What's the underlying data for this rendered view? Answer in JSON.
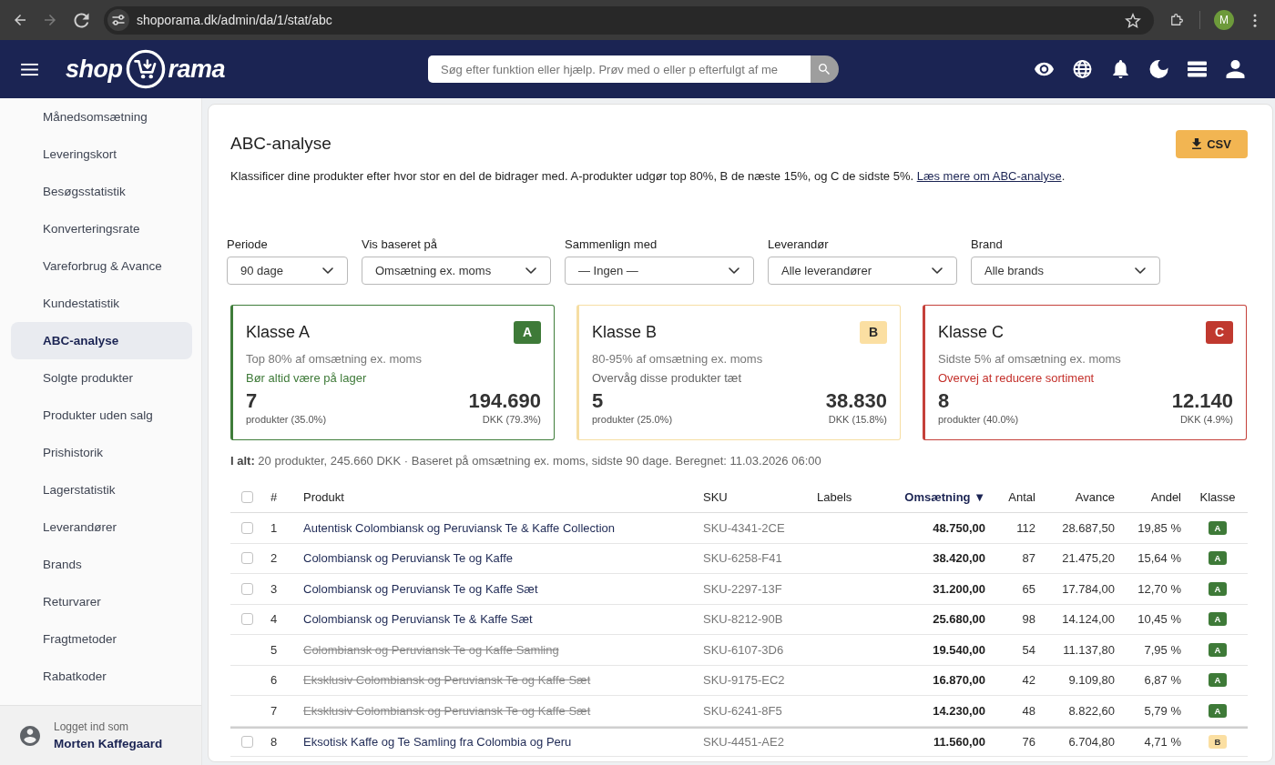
{
  "browser": {
    "url": "shoporama.dk/admin/da/1/stat/abc",
    "avatar": "M"
  },
  "header": {
    "logo": {
      "left": "shop",
      "right": "rama"
    },
    "search": {
      "placeholder": "Søg efter funktion eller hjælp. Prøv med o eller p efterfulgt af me"
    }
  },
  "sidebar": {
    "items": [
      {
        "label": "Månedsomsætning",
        "selected": false
      },
      {
        "label": "Leveringskort",
        "selected": false
      },
      {
        "label": "Besøgsstatistik",
        "selected": false
      },
      {
        "label": "Konverteringsrate",
        "selected": false
      },
      {
        "label": "Vareforbrug & Avance",
        "selected": false
      },
      {
        "label": "Kundestatistik",
        "selected": false
      },
      {
        "label": "ABC-analyse",
        "selected": true
      },
      {
        "label": "Solgte produkter",
        "selected": false
      },
      {
        "label": "Produkter uden salg",
        "selected": false
      },
      {
        "label": "Prishistorik",
        "selected": false
      },
      {
        "label": "Lagerstatistik",
        "selected": false
      },
      {
        "label": "Leverandører",
        "selected": false
      },
      {
        "label": "Brands",
        "selected": false
      },
      {
        "label": "Returvarer",
        "selected": false
      },
      {
        "label": "Fragtmetoder",
        "selected": false
      },
      {
        "label": "Rabatkoder",
        "selected": false
      }
    ],
    "user": {
      "caption": "Logget ind som",
      "name": "Morten Kaffegaard"
    }
  },
  "page": {
    "title": "ABC-analyse",
    "export_button": "CSV",
    "intro": {
      "text": "Klassificer dine produkter efter hvor stor en del de bidrager med. A-produkter udgør top 80%, B de næste 15%, og C de sidste 5%.",
      "link": "Læs mere om ABC-analyse",
      "after": "."
    },
    "filters": [
      {
        "label": "Periode",
        "value": "90 dage"
      },
      {
        "label": "Vis baseret på",
        "value": "Omsætning ex. moms"
      },
      {
        "label": "Sammenlign med",
        "value": "— Ingen —"
      },
      {
        "label": "Leverandør",
        "value": "Alle leverandører"
      },
      {
        "label": "Brand",
        "value": "Alle brands"
      }
    ],
    "class_cards": [
      {
        "kind": "a",
        "title": "Klasse A",
        "badge": "A",
        "description": "Top 80% af omsætning ex. moms",
        "note": "Bør altid være på lager",
        "count": "7",
        "count_caption": "produkter (35.0%)",
        "amount": "194.690",
        "amount_caption": "DKK (79.3%)"
      },
      {
        "kind": "b",
        "title": "Klasse B",
        "badge": "B",
        "description": "80-95% af omsætning ex. moms",
        "note": "Overvåg disse produkter tæt",
        "count": "5",
        "count_caption": "produkter (25.0%)",
        "amount": "38.830",
        "amount_caption": "DKK (15.8%)"
      },
      {
        "kind": "c",
        "title": "Klasse C",
        "badge": "C",
        "description": "Sidste 5% af omsætning ex. moms",
        "note": "Overvej at reducere sortiment",
        "count": "8",
        "count_caption": "produkter (40.0%)",
        "amount": "12.140",
        "amount_caption": "DKK (4.9%)"
      }
    ],
    "summary": "**I alt:** 20 produkter, 245.660 DKK · Baseret på omsætning ex. moms, sidste 90 dage. Beregnet: 11.03.2026 06:00",
    "table": {
      "select_all": {
        "checked": false
      },
      "columns": [
        {
          "label": "#",
          "sorted": false
        },
        {
          "label": "Produkt",
          "sorted": false
        },
        {
          "label": "SKU",
          "sorted": false
        },
        {
          "label": "Labels",
          "sorted": false
        },
        {
          "label": "Omsætning ▼",
          "sorted": true
        },
        {
          "label": "Antal",
          "sorted": false
        },
        {
          "label": "Avance",
          "sorted": false
        },
        {
          "label": "Andel",
          "sorted": false
        },
        {
          "label": "Klasse",
          "sorted": false
        }
      ],
      "rows": [
        {
          "checked": false,
          "crossed_out": false,
          "number": "1",
          "product": "Autentisk Colombiansk og Peruviansk Te & Kaffe Collection",
          "sku": "SKU-4341-2CE",
          "revenue": "48.750,00",
          "quantity": "112",
          "profit": "28.687,50",
          "share": "19,85 %",
          "class": {
            "kind": "a",
            "label": "A"
          }
        },
        {
          "checked": false,
          "crossed_out": false,
          "number": "2",
          "product": "Colombiansk og Peruviansk Te og Kaffe",
          "sku": "SKU-6258-F41",
          "revenue": "38.420,00",
          "quantity": "87",
          "profit": "21.475,20",
          "share": "15,64 %",
          "class": {
            "kind": "a",
            "label": "A"
          }
        },
        {
          "checked": false,
          "crossed_out": false,
          "number": "3",
          "product": "Colombiansk og Peruviansk Te og Kaffe Sæt",
          "sku": "SKU-2297-13F",
          "revenue": "31.200,00",
          "quantity": "65",
          "profit": "17.784,00",
          "share": "12,70 %",
          "class": {
            "kind": "a",
            "label": "A"
          }
        },
        {
          "checked": false,
          "crossed_out": false,
          "number": "4",
          "product": "Colombiansk og Peruviansk Te & Kaffe Sæt",
          "sku": "SKU-8212-90B",
          "revenue": "25.680,00",
          "quantity": "98",
          "profit": "14.124,00",
          "share": "10,45 %",
          "class": {
            "kind": "a",
            "label": "A"
          }
        },
        {
          "crossed_out": true,
          "number": "5",
          "product": "Colombiansk og Peruviansk Te og Kaffe Samling",
          "sku": "SKU-6107-3D6",
          "revenue": "19.540,00",
          "quantity": "54",
          "profit": "11.137,80",
          "share": "7,95 %",
          "class": {
            "kind": "a",
            "label": "A"
          }
        },
        {
          "crossed_out": true,
          "number": "6",
          "product": "Eksklusiv Colombiansk og Peruviansk Te og Kaffe Sæt",
          "sku": "SKU-9175-EC2",
          "revenue": "16.870,00",
          "quantity": "42",
          "profit": "9.109,80",
          "share": "6,87 %",
          "class": {
            "kind": "a",
            "label": "A"
          }
        },
        {
          "crossed_out": true,
          "number": "7",
          "product": "Eksklusiv Colombiansk og Peruviansk Te og Kaffe Sæt",
          "sku": "SKU-6241-8F5",
          "revenue": "14.230,00",
          "quantity": "48",
          "profit": "8.822,60",
          "share": "5,79 %",
          "class": {
            "kind": "a",
            "label": "A"
          }
        },
        {
          "checked": false,
          "crossed_out": false,
          "number": "8",
          "product": "Eksotisk Kaffe og Te Samling fra Colombia og Peru",
          "sku": "SKU-4451-AE2",
          "revenue": "11.560,00",
          "quantity": "76",
          "profit": "6.704,80",
          "share": "4,71 %",
          "class": {
            "kind": "b",
            "label": "B"
          }
        }
      ]
    }
  }
}
